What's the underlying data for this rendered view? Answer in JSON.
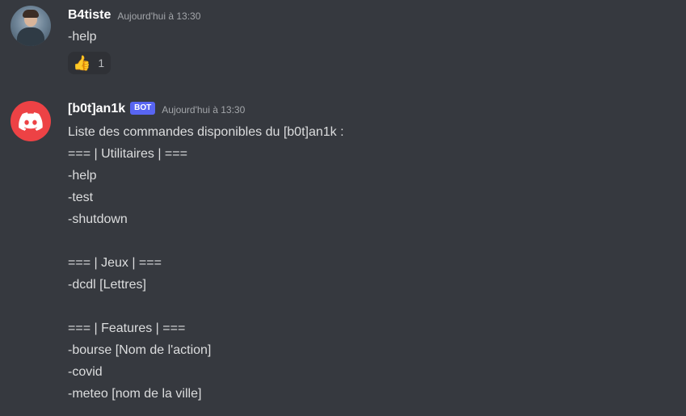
{
  "messages": [
    {
      "author": "B4tiste",
      "timestamp": "Aujourd'hui à 13:30",
      "lines": [
        "-help"
      ],
      "reactions": [
        {
          "emoji": "👍",
          "count": "1"
        }
      ]
    },
    {
      "author": "[b0t]an1k",
      "badge": "BOT",
      "timestamp": "Aujourd'hui à 13:30",
      "lines": [
        "Liste des commandes disponibles du [b0t]an1k :",
        "=== | Utilitaires | ===",
        "-help",
        "-test",
        "-shutdown",
        "",
        "=== | Jeux | ===",
        "-dcdl [Lettres]",
        "",
        "=== | Features | ===",
        "-bourse [Nom de l'action]",
        "-covid",
        "-meteo [nom de la ville]"
      ]
    }
  ],
  "colors": {
    "background": "#36393f",
    "text": "#dcddde",
    "username": "#ffffff",
    "timestamp": "#a3a6aa",
    "bot_badge": "#5865f2",
    "bot_avatar": "#ed4245",
    "reaction_bg": "#2f3136"
  },
  "icons": {
    "bot_avatar": "discord-logo-icon",
    "user_avatar": "user-photo"
  }
}
